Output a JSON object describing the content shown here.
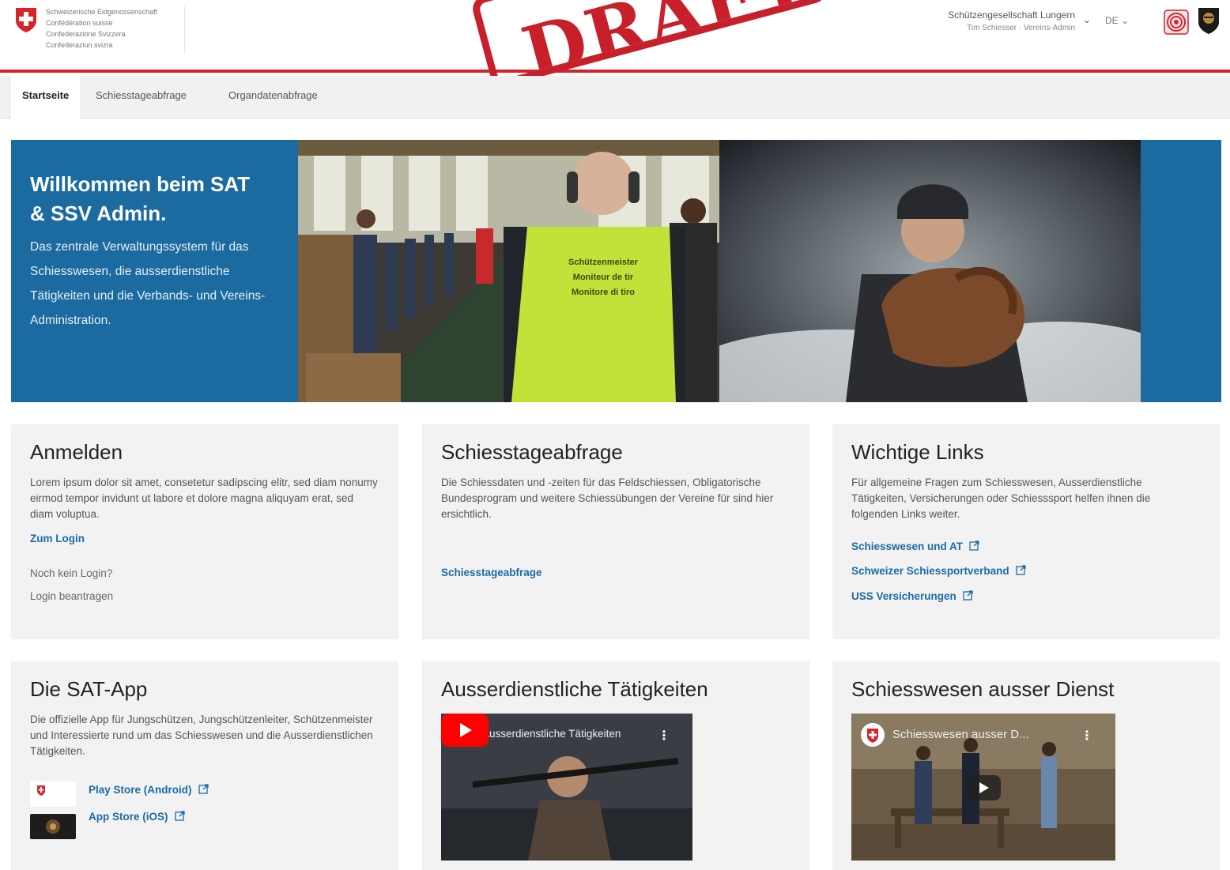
{
  "header": {
    "brand_lines": [
      "Schweizerische Eidgenossenschaft",
      "Confédération suisse",
      "Confederazione Svizzera",
      "Confederaziun svizra"
    ],
    "stamp_text": "DRAFT",
    "user_org": "Schützengesellschaft Lungern",
    "user_name": "Tim Schiesser · Vereins-Admin",
    "language": "DE",
    "colors": {
      "brand_red": "#d8232a",
      "link_blue": "#1d6ba3",
      "hero_blue": "#1b6aa0"
    }
  },
  "nav": {
    "tabs": [
      {
        "label": "Startseite",
        "active": true
      },
      {
        "label": "Schiesstageabfrage",
        "active": false
      },
      {
        "label": "Organdatenabfrage",
        "active": false
      }
    ]
  },
  "hero": {
    "title": "Willkommen beim SAT & SSV Admin.",
    "subtitle": "Das zentrale Verwaltungssystem für das Schiesswesen, die ausserdienstliche Tätigkeiten und die Verbands- und Vereins-Administration.",
    "vest_text": [
      "Schützenmeister",
      "Moniteur de tir",
      "Monitore di tiro"
    ]
  },
  "cards": {
    "login": {
      "title": "Anmelden",
      "text": "Lorem ipsum dolor sit amet, consetetur sadipscing elitr, sed diam nonumy eirmod tempor invidunt ut labore et dolore magna aliquyam erat, sed diam voluptua.",
      "link": "Zum Login",
      "no_login": "Noch kein Login?",
      "request": "Login beantragen"
    },
    "schiesstage": {
      "title": "Schiesstageabfrage",
      "text": "Die Schiessdaten und -zeiten für das Feldschiessen, Obligatorische Bundesprogram und weitere Schiessübungen der Vereine für sind hier ersichtlich.",
      "link": "Schiesstageabfrage"
    },
    "links": {
      "title": "Wichtige Links",
      "text": "Für allgemeine Fragen zum Schiesswesen, Ausserdienstliche Tätigkeiten, Versicherungen oder Schiesssport helfen ihnen die folgenden Links weiter.",
      "items": [
        "Schiesswesen und AT",
        "Schweizer Schiessportverband",
        "USS Versicherungen"
      ]
    },
    "app": {
      "title": "Die SAT-App",
      "text": "Die offizielle App für Jungschützen, Jungschützenleiter, Schützenmeister und Interessierte rund um das Schiesswesen und die Ausserdienstlichen Tätigkeiten.",
      "play": "Play Store (Android)",
      "appstore": "App Store (iOS)"
    },
    "at": {
      "title": "Ausserdienstliche Tätigkeiten",
      "video_title": "Ausserdienstliche Tätigkeiten"
    },
    "sad": {
      "title": "Schiesswesen ausser Dienst",
      "video_title": "Schiesswesen ausser D..."
    }
  }
}
